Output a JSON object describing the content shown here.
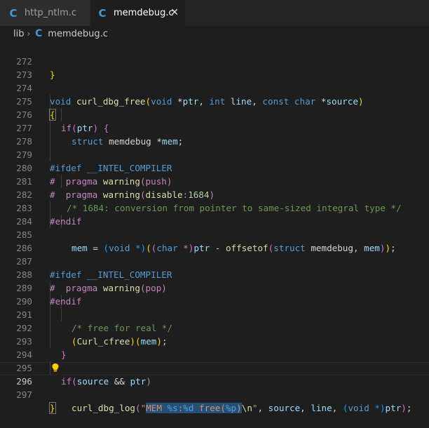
{
  "tabs": [
    {
      "label": "http_ntlm.c",
      "icon": "c-file-icon",
      "active": false
    },
    {
      "label": "memdebug.c",
      "icon": "c-file-icon",
      "active": true
    }
  ],
  "breadcrumb": {
    "folder": "lib",
    "file": "memdebug.c"
  },
  "icon_glyph": "C",
  "close_glyph": "✕",
  "chevron_glyph": "›",
  "line_numbers": [
    "272",
    "273",
    "274",
    "275",
    "276",
    "277",
    "278",
    "279",
    "280",
    "281",
    "282",
    "283",
    "284",
    "285",
    "286",
    "287",
    "288",
    "289",
    "290",
    "291",
    "292",
    "293",
    "294",
    "295",
    "296",
    "297"
  ],
  "active_line": "296",
  "code": {
    "l272": "}",
    "l274_void": "void",
    "l274_fn": "curl_dbg_free",
    "l274_p1": "(",
    "l274_void2": "void",
    "l274_star": " *",
    "l274_ptr": "ptr",
    "l274_comma1": ", ",
    "l274_int": "int",
    "l274_sp": " ",
    "l274_line": "line",
    "l274_comma2": ", ",
    "l274_const": "const",
    "l274_sp2": " ",
    "l274_char": "char",
    "l274_star2": " *",
    "l274_source": "source",
    "l274_p2": ")",
    "l275": "{",
    "l276_if": "if",
    "l276_p1": "(",
    "l276_ptr": "ptr",
    "l276_p2": ")",
    "l276_br": " {",
    "l277_struct": "struct",
    "l277_rest": " memdebug *",
    "l277_mem": "mem",
    "l277_semi": ";",
    "pp_ifdef": "#ifdef",
    "pp_intel": "__INTEL_COMPILER",
    "pp_hash": "#",
    "pp_pragma": "  pragma",
    "l280_warning": "warning",
    "l280_p1": "(",
    "l280_push": "push",
    "l280_p2": ")",
    "l281_warning": "warning",
    "l281_p1": "(",
    "l281_disable": "disable",
    "l281_colon": ":",
    "l281_num": "1684",
    "l281_p2": ")",
    "l282_comment": "/* 1684: conversion from pointer to same-sized integral type */",
    "pp_endif": "#endif",
    "l285_mem": "mem",
    "l285_eq": " = ",
    "l285_p1": "(",
    "l285_void": "void",
    "l285_star": " *)",
    "l285_p2": "(",
    "l285_p3": "(",
    "l285_char": "char",
    "l285_star2": " *)",
    "l285_ptr": "ptr",
    "l285_minus": " - ",
    "l285_offsetof": "offsetof",
    "l285_p4": "(",
    "l285_struct": "struct",
    "l285_memdebug": " memdebug, ",
    "l285_mem2": "mem",
    "l285_p5": ")",
    "l285_p6": ")",
    "l285_semi": ";",
    "l288_warning": "warning",
    "l288_p1": "(",
    "l288_pop": "pop",
    "l288_p2": ")",
    "l291_comment": "/* free for real */",
    "l292_p1": "(",
    "l292_cfree": "Curl_cfree",
    "l292_p2": ")",
    "l292_p3": "(",
    "l292_mem": "mem",
    "l292_p4": ")",
    "l292_semi": ";",
    "l293": "}",
    "l295_if": "if",
    "l295_p1": "(",
    "l295_source": "source",
    "l295_and": " && ",
    "l295_ptr": "ptr",
    "l295_p2": ")",
    "l296_fn": "curl_dbg_log",
    "l296_p1": "(",
    "l296_q": "\"",
    "l296_sel1": "MEM ",
    "l296_fmt1": "%s",
    "l296_sel2": ":",
    "l296_fmt2": "%d",
    "l296_sel3": " free(",
    "l296_fmt3": "%p",
    "l296_sel4": ")",
    "l296_esc": "\\n",
    "l296_q2": "\"",
    "l296_rest1": ", ",
    "l296_source": "source",
    "l296_rest2": ", ",
    "l296_line": "line",
    "l296_rest3": ", ",
    "l296_p2": "(",
    "l296_void": "void",
    "l296_star": " *)",
    "l296_ptr": "ptr",
    "l296_p3": ")",
    "l296_semi": ";",
    "l297": "}"
  },
  "colors": {
    "background": "#1e1e1e",
    "keyword": "#569cd6",
    "control": "#c586c0",
    "function": "#dcdcaa",
    "variable": "#9cdcfe",
    "string": "#ce9178",
    "comment": "#6a9955",
    "number": "#b5cea8",
    "selection": "#264f78",
    "c_icon": "#3e9ad6"
  }
}
